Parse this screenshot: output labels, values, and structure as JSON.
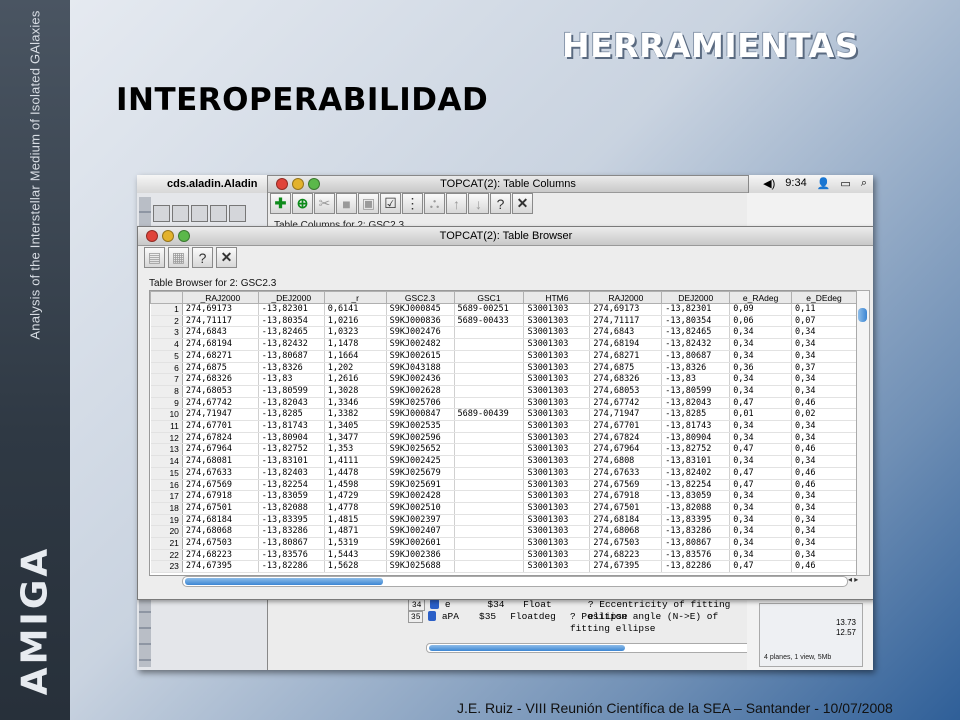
{
  "slide": {
    "sidebar_text": "Analysis of the Interstellar Medium of Isolated GAlaxies",
    "sidebar_logo": "AMIGA",
    "title_main": "HERRAMIENTAS",
    "title_sub": "INTEROPERABILIDAD",
    "footer": "J.E. Ruiz - VIII Reunión Científica de la SEA – Santander - 10/07/2008"
  },
  "mac": {
    "app_name": "cds.aladin.Aladin",
    "clock": "9:34"
  },
  "columns_window": {
    "title": "TOPCAT(2): Table Columns",
    "subtitle": "Table Columns for 2: GSC2.3",
    "rows": [
      {
        "n": "34",
        "name": "e",
        "ref": "$34",
        "type": "Float",
        "unit": "",
        "desc": "? Eccentricity of fitting ellipse"
      },
      {
        "n": "35",
        "name": "aPA",
        "ref": "$35",
        "type": "Float",
        "unit": "deg",
        "desc": "? Position angle (N->E) of fitting ellipse"
      }
    ]
  },
  "aladin_panel": {
    "values": [
      "13.73",
      "12.57"
    ],
    "status": "4 planes, 1 view, 5Mb"
  },
  "browser": {
    "title": "TOPCAT(2): Table Browser",
    "label": "Table Browser for 2: GSC2.3",
    "columns": [
      "",
      "_RAJ2000",
      "_DEJ2000",
      "_r",
      "GSC2.3",
      "GSC1",
      "HTM6",
      "RAJ2000",
      "DEJ2000",
      "e_RAdeg",
      "e_DEdeg"
    ],
    "rows": [
      [
        "1",
        "274,69173",
        "-13,82301",
        "0,6141",
        "S9KJ000845",
        "5689-00251",
        "S3001303",
        "274,69173",
        "-13,82301",
        "0,09",
        "0,11"
      ],
      [
        "2",
        "274,71117",
        "-13,80354",
        "1,0216",
        "S9KJ000836",
        "5689-00433",
        "S3001303",
        "274,71117",
        "-13,80354",
        "0,06",
        "0,07"
      ],
      [
        "3",
        "274,6843",
        "-13,82465",
        "1,0323",
        "S9KJ002476",
        "",
        "S3001303",
        "274,6843",
        "-13,82465",
        "0,34",
        "0,34"
      ],
      [
        "4",
        "274,68194",
        "-13,82432",
        "1,1478",
        "S9KJ002482",
        "",
        "S3001303",
        "274,68194",
        "-13,82432",
        "0,34",
        "0,34"
      ],
      [
        "5",
        "274,68271",
        "-13,80687",
        "1,1664",
        "S9KJ002615",
        "",
        "S3001303",
        "274,68271",
        "-13,80687",
        "0,34",
        "0,34"
      ],
      [
        "6",
        "274,6875",
        "-13,8326",
        "1,202",
        "S9KJ043188",
        "",
        "S3001303",
        "274,6875",
        "-13,8326",
        "0,36",
        "0,37"
      ],
      [
        "7",
        "274,68326",
        "-13,83",
        "1,2616",
        "S9KJ002436",
        "",
        "S3001303",
        "274,68326",
        "-13,83",
        "0,34",
        "0,34"
      ],
      [
        "8",
        "274,68053",
        "-13,80599",
        "1,3028",
        "S9KJ002628",
        "",
        "S3001303",
        "274,68053",
        "-13,80599",
        "0,34",
        "0,34"
      ],
      [
        "9",
        "274,67742",
        "-13,82043",
        "1,3346",
        "S9KJ025706",
        "",
        "S3001303",
        "274,67742",
        "-13,82043",
        "0,47",
        "0,46"
      ],
      [
        "10",
        "274,71947",
        "-13,8285",
        "1,3382",
        "S9KJ000847",
        "5689-00439",
        "S3001303",
        "274,71947",
        "-13,8285",
        "0,01",
        "0,02"
      ],
      [
        "11",
        "274,67701",
        "-13,81743",
        "1,3405",
        "S9KJ002535",
        "",
        "S3001303",
        "274,67701",
        "-13,81743",
        "0,34",
        "0,34"
      ],
      [
        "12",
        "274,67824",
        "-13,80904",
        "1,3477",
        "S9KJ002596",
        "",
        "S3001303",
        "274,67824",
        "-13,80904",
        "0,34",
        "0,34"
      ],
      [
        "13",
        "274,67964",
        "-13,82752",
        "1,353",
        "S9KJ025652",
        "",
        "S3001303",
        "274,67964",
        "-13,82752",
        "0,47",
        "0,46"
      ],
      [
        "14",
        "274,68081",
        "-13,83101",
        "1,4111",
        "S9KJ002425",
        "",
        "S3001303",
        "274,6808",
        "-13,83101",
        "0,34",
        "0,34"
      ],
      [
        "15",
        "274,67633",
        "-13,82403",
        "1,4478",
        "S9KJ025679",
        "",
        "S3001303",
        "274,67633",
        "-13,82402",
        "0,47",
        "0,46"
      ],
      [
        "16",
        "274,67569",
        "-13,82254",
        "1,4598",
        "S9KJ025691",
        "",
        "S3001303",
        "274,67569",
        "-13,82254",
        "0,47",
        "0,46"
      ],
      [
        "17",
        "274,67918",
        "-13,83059",
        "1,4729",
        "S9KJ002428",
        "",
        "S3001303",
        "274,67918",
        "-13,83059",
        "0,34",
        "0,34"
      ],
      [
        "18",
        "274,67501",
        "-13,82088",
        "1,4778",
        "S9KJ002510",
        "",
        "S3001303",
        "274,67501",
        "-13,82088",
        "0,34",
        "0,34"
      ],
      [
        "19",
        "274,68184",
        "-13,83395",
        "1,4815",
        "S9KJ002397",
        "",
        "S3001303",
        "274,68184",
        "-13,83395",
        "0,34",
        "0,34"
      ],
      [
        "20",
        "274,68068",
        "-13,83286",
        "1,4871",
        "S9KJ002407",
        "",
        "S3001303",
        "274,68068",
        "-13,83286",
        "0,34",
        "0,34"
      ],
      [
        "21",
        "274,67503",
        "-13,80867",
        "1,5319",
        "S9KJ002601",
        "",
        "S3001303",
        "274,67503",
        "-13,80867",
        "0,34",
        "0,34"
      ],
      [
        "22",
        "274,68223",
        "-13,83576",
        "1,5443",
        "S9KJ002386",
        "",
        "S3001303",
        "274,68223",
        "-13,83576",
        "0,34",
        "0,34"
      ],
      [
        "23",
        "274,67395",
        "-13,82286",
        "1,5628",
        "S9KJ025688",
        "",
        "S3001303",
        "274,67395",
        "-13,82286",
        "0,47",
        "0,46"
      ]
    ]
  }
}
